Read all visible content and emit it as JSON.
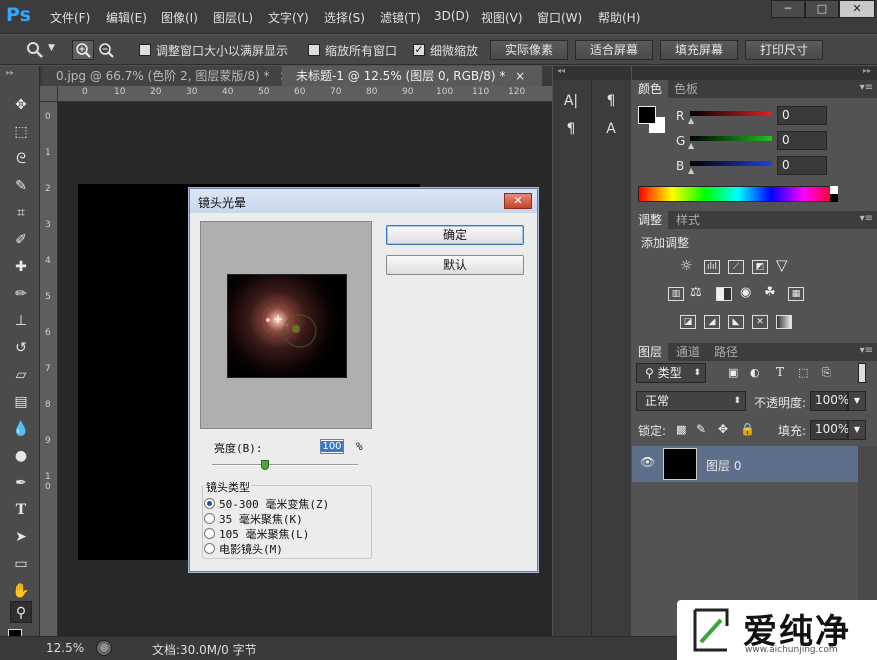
{
  "app": {
    "logo": "Ps"
  },
  "menu": [
    "文件(F)",
    "编辑(E)",
    "图像(I)",
    "图层(L)",
    "文字(Y)",
    "选择(S)",
    "滤镜(T)",
    "3D(D)",
    "视图(V)",
    "窗口(W)",
    "帮助(H)"
  ],
  "window_controls": {
    "minimize": "─",
    "maximize": "□",
    "close": "✕"
  },
  "options": {
    "zoom_icon": "zoom-icon",
    "checkboxes": [
      {
        "label": "调整窗口大小以满屏显示",
        "checked": false
      },
      {
        "label": "缩放所有窗口",
        "checked": false
      },
      {
        "label": "细微缩放",
        "checked": true
      }
    ],
    "buttons": [
      "实际像素",
      "适合屏幕",
      "填充屏幕",
      "打印尺寸"
    ]
  },
  "tabs": [
    {
      "label": "0.jpg @ 66.7% (色阶 2, 图层蒙版/8) *",
      "close": "×"
    },
    {
      "label": "未标题-1 @ 12.5% (图层 0, RGB/8) *",
      "close": "×"
    }
  ],
  "ruler": {
    "h": [
      "0",
      "10",
      "20",
      "30",
      "40",
      "50",
      "60",
      "70",
      "80",
      "90",
      "100",
      "110",
      "120"
    ],
    "v": [
      "0",
      "1",
      "2",
      "3",
      "4",
      "5",
      "6",
      "7",
      "8",
      "9",
      "1",
      "0"
    ]
  },
  "panels": {
    "color": {
      "tabs": [
        "颜色",
        "色板"
      ],
      "channels": [
        {
          "label": "R",
          "value": "0",
          "color": "#e02020"
        },
        {
          "label": "G",
          "value": "0",
          "color": "#20c020"
        },
        {
          "label": "B",
          "value": "0",
          "color": "#2040e0"
        }
      ]
    },
    "adjustments": {
      "tabs": [
        "调整",
        "样式"
      ],
      "title": "添加调整"
    },
    "layers": {
      "tabs": [
        "图层",
        "通道",
        "路径"
      ],
      "kind": "类型",
      "blend": "正常",
      "opacity_label": "不透明度:",
      "opacity": "100%",
      "lock_label": "锁定:",
      "fill_label": "填充:",
      "fill": "100%",
      "layer_name": "图层 0"
    }
  },
  "status": {
    "zoom": "12.5%",
    "doc": "文档:30.0M/0 字节"
  },
  "dialog": {
    "title": "镜头光晕",
    "close": "✕",
    "ok": "确定",
    "default": "默认",
    "brightness_label": "亮度(B):",
    "brightness_value": "100",
    "percent": "%",
    "lens_group": "镜头类型",
    "lens_options": [
      {
        "label": "50-300 毫米变焦(Z)",
        "selected": true
      },
      {
        "label": "35 毫米聚焦(K)",
        "selected": false
      },
      {
        "label": "105 毫米聚焦(L)",
        "selected": false
      },
      {
        "label": "电影镜头(M)",
        "selected": false
      }
    ],
    "slider_position": 0.36
  },
  "watermark": {
    "brand": "爱纯净",
    "url": "www.aichunjing.com"
  }
}
